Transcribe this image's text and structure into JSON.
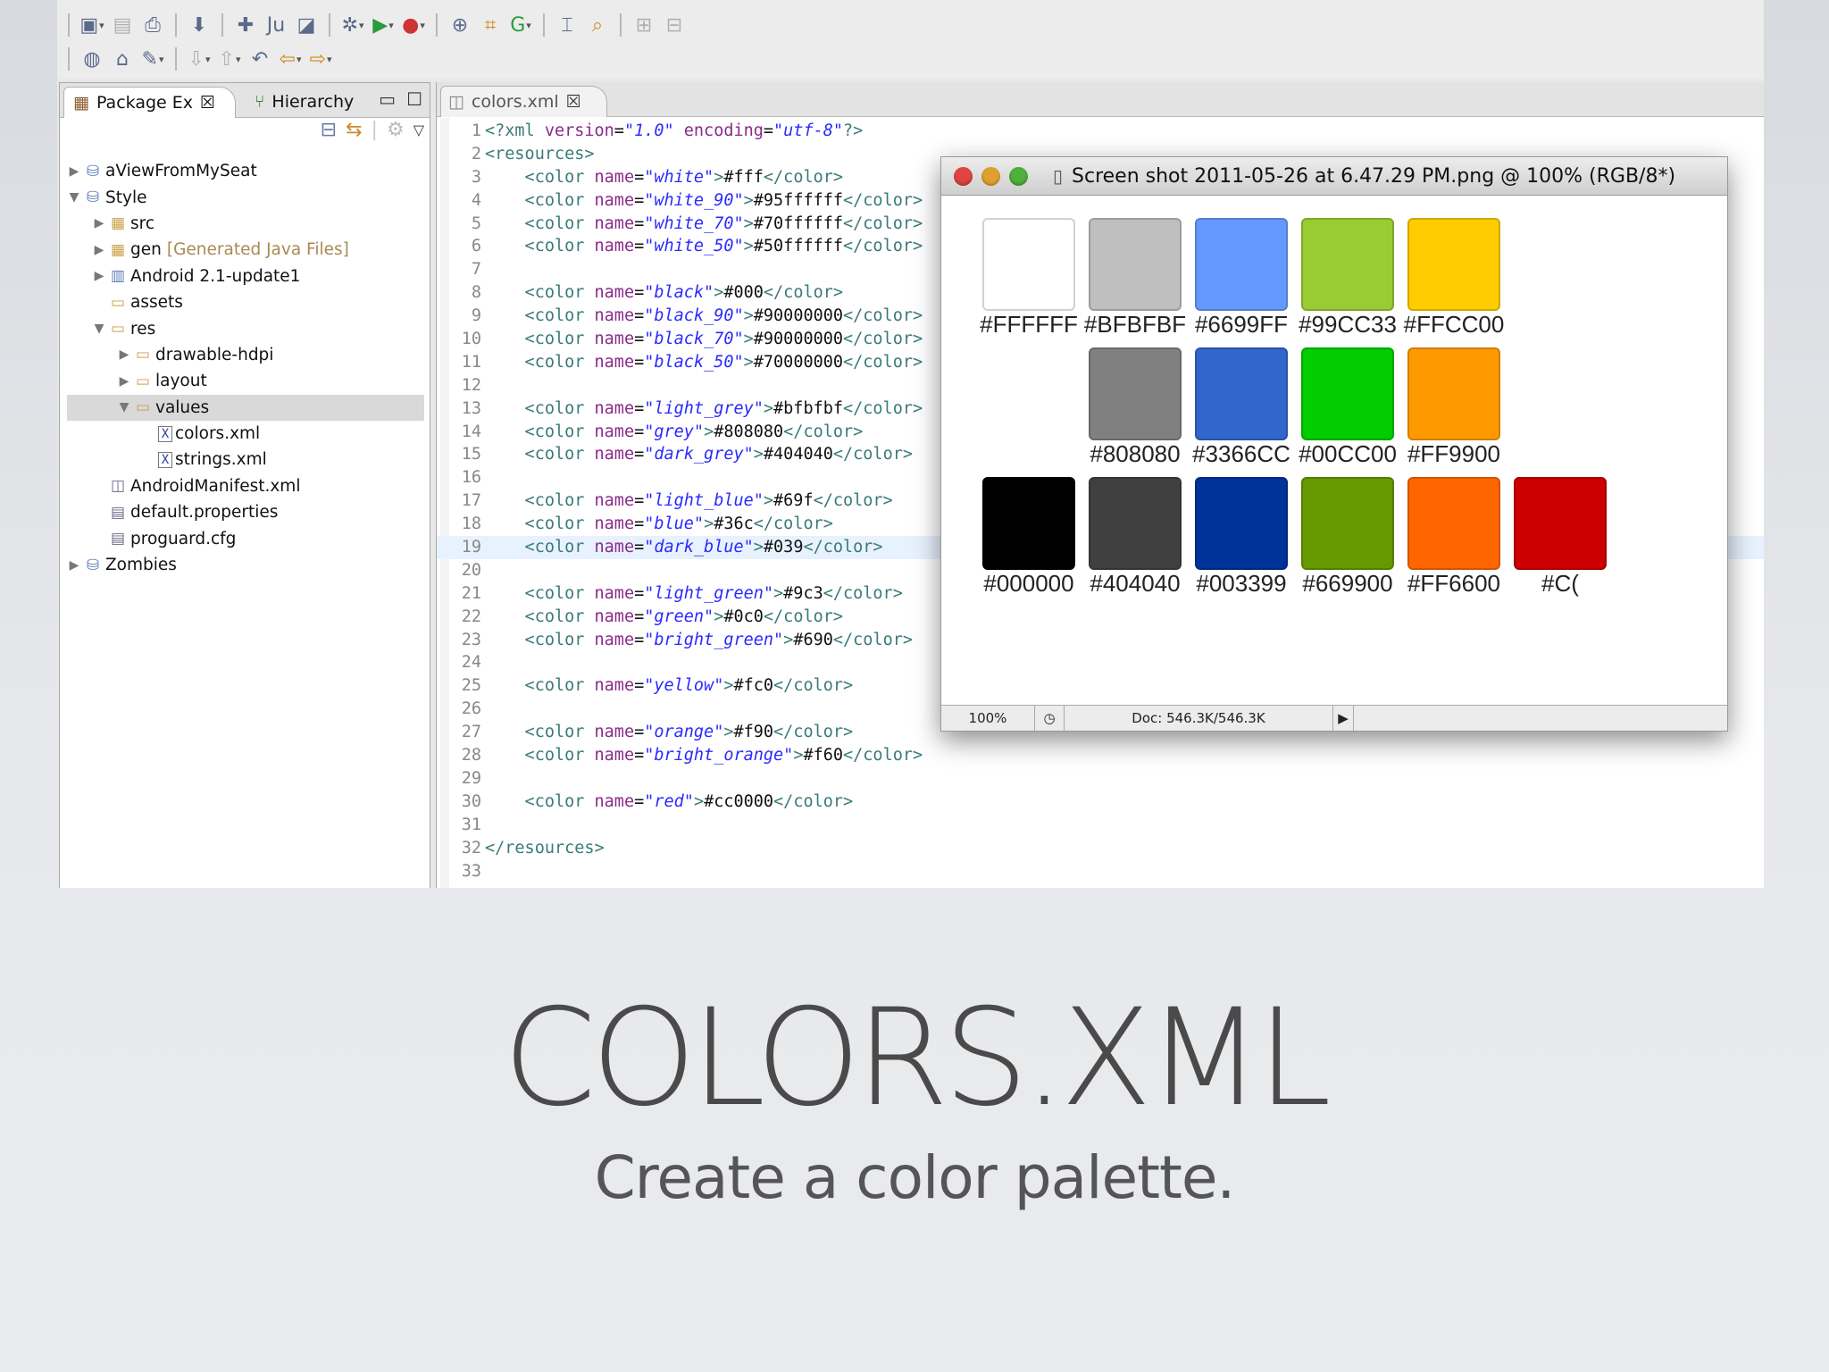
{
  "package_explorer": {
    "tabs": [
      {
        "label": "Package Ex",
        "close": "☒"
      },
      {
        "label": "Hierarchy"
      }
    ],
    "tree": [
      {
        "label": "aViewFromMySeat",
        "depth": 0,
        "twisty": "▶",
        "icon": "project-icon"
      },
      {
        "label": "Style",
        "depth": 0,
        "twisty": "▼",
        "icon": "project-icon"
      },
      {
        "label": "src",
        "depth": 1,
        "twisty": "▶",
        "icon": "package-folder-icon"
      },
      {
        "label": "gen",
        "note": "[Generated Java Files]",
        "depth": 1,
        "twisty": "▶",
        "icon": "package-folder-icon"
      },
      {
        "label": "Android 2.1-update1",
        "depth": 1,
        "twisty": "▶",
        "icon": "library-icon"
      },
      {
        "label": "assets",
        "depth": 1,
        "twisty": "",
        "icon": "folder-icon"
      },
      {
        "label": "res",
        "depth": 1,
        "twisty": "▼",
        "icon": "folder-icon"
      },
      {
        "label": "drawable-hdpi",
        "depth": 2,
        "twisty": "▶",
        "icon": "folder-icon"
      },
      {
        "label": "layout",
        "depth": 2,
        "twisty": "▶",
        "icon": "folder-icon"
      },
      {
        "label": "values",
        "depth": 2,
        "twisty": "▼",
        "icon": "folder-icon",
        "selected": true
      },
      {
        "label": "colors.xml",
        "depth": 3,
        "twisty": "",
        "icon": "xml-file-icon"
      },
      {
        "label": "strings.xml",
        "depth": 3,
        "twisty": "",
        "icon": "xml-file-icon"
      },
      {
        "label": "AndroidManifest.xml",
        "depth": 1,
        "twisty": "",
        "icon": "manifest-file-icon"
      },
      {
        "label": "default.properties",
        "depth": 1,
        "twisty": "",
        "icon": "file-icon"
      },
      {
        "label": "proguard.cfg",
        "depth": 1,
        "twisty": "",
        "icon": "file-icon"
      },
      {
        "label": "Zombies",
        "depth": 0,
        "twisty": "▶",
        "icon": "project-icon"
      }
    ]
  },
  "editor": {
    "tab_label": "colors.xml",
    "tab_close": "☒",
    "highlight_line": 19,
    "lines": [
      {
        "n": "1",
        "t": [
          [
            "tag",
            "<?xml "
          ],
          [
            "attr",
            "version"
          ],
          [
            "txt",
            "="
          ],
          [
            "sv",
            "\"1.0\""
          ],
          [
            "txt",
            " "
          ],
          [
            "attr",
            "encoding"
          ],
          [
            "txt",
            "="
          ],
          [
            "sv",
            "\"utf-8\""
          ],
          [
            "tag",
            "?>"
          ]
        ]
      },
      {
        "n": "2",
        "t": [
          [
            "tag",
            "<resources>"
          ]
        ]
      },
      {
        "n": "3",
        "t": [
          [
            "tag",
            "    <color "
          ],
          [
            "attr",
            "name"
          ],
          [
            "txt",
            "="
          ],
          [
            "sv",
            "\"white\""
          ],
          [
            "tag",
            ">"
          ],
          [
            "txt",
            "#fff"
          ],
          [
            "tag",
            "</color>"
          ]
        ]
      },
      {
        "n": "4",
        "t": [
          [
            "tag",
            "    <color "
          ],
          [
            "attr",
            "name"
          ],
          [
            "txt",
            "="
          ],
          [
            "sv",
            "\"white_90\""
          ],
          [
            "tag",
            ">"
          ],
          [
            "txt",
            "#95ffffff"
          ],
          [
            "tag",
            "</color>"
          ]
        ]
      },
      {
        "n": "5",
        "t": [
          [
            "tag",
            "    <color "
          ],
          [
            "attr",
            "name"
          ],
          [
            "txt",
            "="
          ],
          [
            "sv",
            "\"white_70\""
          ],
          [
            "tag",
            ">"
          ],
          [
            "txt",
            "#70ffffff"
          ],
          [
            "tag",
            "</color>"
          ]
        ]
      },
      {
        "n": "6",
        "t": [
          [
            "tag",
            "    <color "
          ],
          [
            "attr",
            "name"
          ],
          [
            "txt",
            "="
          ],
          [
            "sv",
            "\"white_50\""
          ],
          [
            "tag",
            ">"
          ],
          [
            "txt",
            "#50ffffff"
          ],
          [
            "tag",
            "</color>"
          ]
        ]
      },
      {
        "n": "7",
        "t": []
      },
      {
        "n": "8",
        "t": [
          [
            "tag",
            "    <color "
          ],
          [
            "attr",
            "name"
          ],
          [
            "txt",
            "="
          ],
          [
            "sv",
            "\"black\""
          ],
          [
            "tag",
            ">"
          ],
          [
            "txt",
            "#000"
          ],
          [
            "tag",
            "</color>"
          ]
        ]
      },
      {
        "n": "9",
        "t": [
          [
            "tag",
            "    <color "
          ],
          [
            "attr",
            "name"
          ],
          [
            "txt",
            "="
          ],
          [
            "sv",
            "\"black_90\""
          ],
          [
            "tag",
            ">"
          ],
          [
            "txt",
            "#90000000"
          ],
          [
            "tag",
            "</color>"
          ]
        ]
      },
      {
        "n": "10",
        "t": [
          [
            "tag",
            "    <color "
          ],
          [
            "attr",
            "name"
          ],
          [
            "txt",
            "="
          ],
          [
            "sv",
            "\"black_70\""
          ],
          [
            "tag",
            ">"
          ],
          [
            "txt",
            "#90000000"
          ],
          [
            "tag",
            "</color>"
          ]
        ]
      },
      {
        "n": "11",
        "t": [
          [
            "tag",
            "    <color "
          ],
          [
            "attr",
            "name"
          ],
          [
            "txt",
            "="
          ],
          [
            "sv",
            "\"black_50\""
          ],
          [
            "tag",
            ">"
          ],
          [
            "txt",
            "#70000000"
          ],
          [
            "tag",
            "</color>"
          ]
        ]
      },
      {
        "n": "12",
        "t": []
      },
      {
        "n": "13",
        "t": [
          [
            "tag",
            "    <color "
          ],
          [
            "attr",
            "name"
          ],
          [
            "txt",
            "="
          ],
          [
            "sv",
            "\"light_grey\""
          ],
          [
            "tag",
            ">"
          ],
          [
            "txt",
            "#bfbfbf"
          ],
          [
            "tag",
            "</color>"
          ]
        ]
      },
      {
        "n": "14",
        "t": [
          [
            "tag",
            "    <color "
          ],
          [
            "attr",
            "name"
          ],
          [
            "txt",
            "="
          ],
          [
            "sv",
            "\"grey\""
          ],
          [
            "tag",
            ">"
          ],
          [
            "txt",
            "#808080"
          ],
          [
            "tag",
            "</color>"
          ]
        ]
      },
      {
        "n": "15",
        "t": [
          [
            "tag",
            "    <color "
          ],
          [
            "attr",
            "name"
          ],
          [
            "txt",
            "="
          ],
          [
            "sv",
            "\"dark_grey\""
          ],
          [
            "tag",
            ">"
          ],
          [
            "txt",
            "#404040"
          ],
          [
            "tag",
            "</color>"
          ]
        ]
      },
      {
        "n": "16",
        "t": []
      },
      {
        "n": "17",
        "t": [
          [
            "tag",
            "    <color "
          ],
          [
            "attr",
            "name"
          ],
          [
            "txt",
            "="
          ],
          [
            "sv",
            "\"light_blue\""
          ],
          [
            "tag",
            ">"
          ],
          [
            "txt",
            "#69f"
          ],
          [
            "tag",
            "</color>"
          ]
        ]
      },
      {
        "n": "18",
        "t": [
          [
            "tag",
            "    <color "
          ],
          [
            "attr",
            "name"
          ],
          [
            "txt",
            "="
          ],
          [
            "sv",
            "\"blue\""
          ],
          [
            "tag",
            ">"
          ],
          [
            "txt",
            "#36c"
          ],
          [
            "tag",
            "</color>"
          ]
        ]
      },
      {
        "n": "19",
        "t": [
          [
            "tag",
            "    <color "
          ],
          [
            "attr",
            "name"
          ],
          [
            "txt",
            "="
          ],
          [
            "sv",
            "\"dark_blue\""
          ],
          [
            "tag",
            ">"
          ],
          [
            "txt",
            "#039"
          ],
          [
            "tag",
            "</color>"
          ]
        ]
      },
      {
        "n": "20",
        "t": []
      },
      {
        "n": "21",
        "t": [
          [
            "tag",
            "    <color "
          ],
          [
            "attr",
            "name"
          ],
          [
            "txt",
            "="
          ],
          [
            "sv",
            "\"light_green\""
          ],
          [
            "tag",
            ">"
          ],
          [
            "txt",
            "#9c3"
          ],
          [
            "tag",
            "</color>"
          ]
        ]
      },
      {
        "n": "22",
        "t": [
          [
            "tag",
            "    <color "
          ],
          [
            "attr",
            "name"
          ],
          [
            "txt",
            "="
          ],
          [
            "sv",
            "\"green\""
          ],
          [
            "tag",
            ">"
          ],
          [
            "txt",
            "#0c0"
          ],
          [
            "tag",
            "</color>"
          ]
        ]
      },
      {
        "n": "23",
        "t": [
          [
            "tag",
            "    <color "
          ],
          [
            "attr",
            "name"
          ],
          [
            "txt",
            "="
          ],
          [
            "sv",
            "\"bright_green\""
          ],
          [
            "tag",
            ">"
          ],
          [
            "txt",
            "#690"
          ],
          [
            "tag",
            "</color>"
          ]
        ]
      },
      {
        "n": "24",
        "t": []
      },
      {
        "n": "25",
        "t": [
          [
            "tag",
            "    <color "
          ],
          [
            "attr",
            "name"
          ],
          [
            "txt",
            "="
          ],
          [
            "sv",
            "\"yellow\""
          ],
          [
            "tag",
            ">"
          ],
          [
            "txt",
            "#fc0"
          ],
          [
            "tag",
            "</color>"
          ]
        ]
      },
      {
        "n": "26",
        "t": []
      },
      {
        "n": "27",
        "t": [
          [
            "tag",
            "    <color "
          ],
          [
            "attr",
            "name"
          ],
          [
            "txt",
            "="
          ],
          [
            "sv",
            "\"orange\""
          ],
          [
            "tag",
            ">"
          ],
          [
            "txt",
            "#f90"
          ],
          [
            "tag",
            "</color>"
          ]
        ]
      },
      {
        "n": "28",
        "t": [
          [
            "tag",
            "    <color "
          ],
          [
            "attr",
            "name"
          ],
          [
            "txt",
            "="
          ],
          [
            "sv",
            "\"bright_orange\""
          ],
          [
            "tag",
            ">"
          ],
          [
            "txt",
            "#f60"
          ],
          [
            "tag",
            "</color>"
          ]
        ]
      },
      {
        "n": "29",
        "t": []
      },
      {
        "n": "30",
        "t": [
          [
            "tag",
            "    <color "
          ],
          [
            "attr",
            "name"
          ],
          [
            "txt",
            "="
          ],
          [
            "sv",
            "\"red\""
          ],
          [
            "tag",
            ">"
          ],
          [
            "txt",
            "#cc0000"
          ],
          [
            "tag",
            "</color>"
          ]
        ]
      },
      {
        "n": "31",
        "t": []
      },
      {
        "n": "32",
        "t": [
          [
            "tag",
            "</resources>"
          ]
        ]
      },
      {
        "n": "33",
        "t": []
      }
    ]
  },
  "preview_window": {
    "title": "Screen shot 2011-05-26 at 6.47.29 PM.png @ 100% (RGB/8*)",
    "swatches": [
      {
        "row": 0,
        "col": 0,
        "color": "#FFFFFF",
        "label": "#FFFFFF"
      },
      {
        "row": 0,
        "col": 1,
        "color": "#BFBFBF",
        "label": "#BFBFBF"
      },
      {
        "row": 0,
        "col": 2,
        "color": "#6699FF",
        "label": "#6699FF"
      },
      {
        "row": 0,
        "col": 3,
        "color": "#99CC33",
        "label": "#99CC33"
      },
      {
        "row": 0,
        "col": 4,
        "color": "#FFCC00",
        "label": "#FFCC00"
      },
      {
        "row": 1,
        "col": 1,
        "color": "#808080",
        "label": "#808080"
      },
      {
        "row": 1,
        "col": 2,
        "color": "#3366CC",
        "label": "#3366CC"
      },
      {
        "row": 1,
        "col": 3,
        "color": "#00CC00",
        "label": "#00CC00"
      },
      {
        "row": 1,
        "col": 4,
        "color": "#FF9900",
        "label": "#FF9900"
      },
      {
        "row": 2,
        "col": 0,
        "color": "#000000",
        "label": "#000000"
      },
      {
        "row": 2,
        "col": 1,
        "color": "#404040",
        "label": "#404040"
      },
      {
        "row": 2,
        "col": 2,
        "color": "#003399",
        "label": "#003399"
      },
      {
        "row": 2,
        "col": 3,
        "color": "#669900",
        "label": "#669900"
      },
      {
        "row": 2,
        "col": 4,
        "color": "#FF6600",
        "label": "#FF6600"
      },
      {
        "row": 2,
        "col": 5,
        "color": "#CC0000",
        "label": "#C("
      }
    ],
    "status": {
      "zoom": "100%",
      "doc": "Doc: 546.3K/546.3K"
    }
  },
  "slide": {
    "title": "COLORS.XML",
    "subtitle": "Create a color palette."
  }
}
